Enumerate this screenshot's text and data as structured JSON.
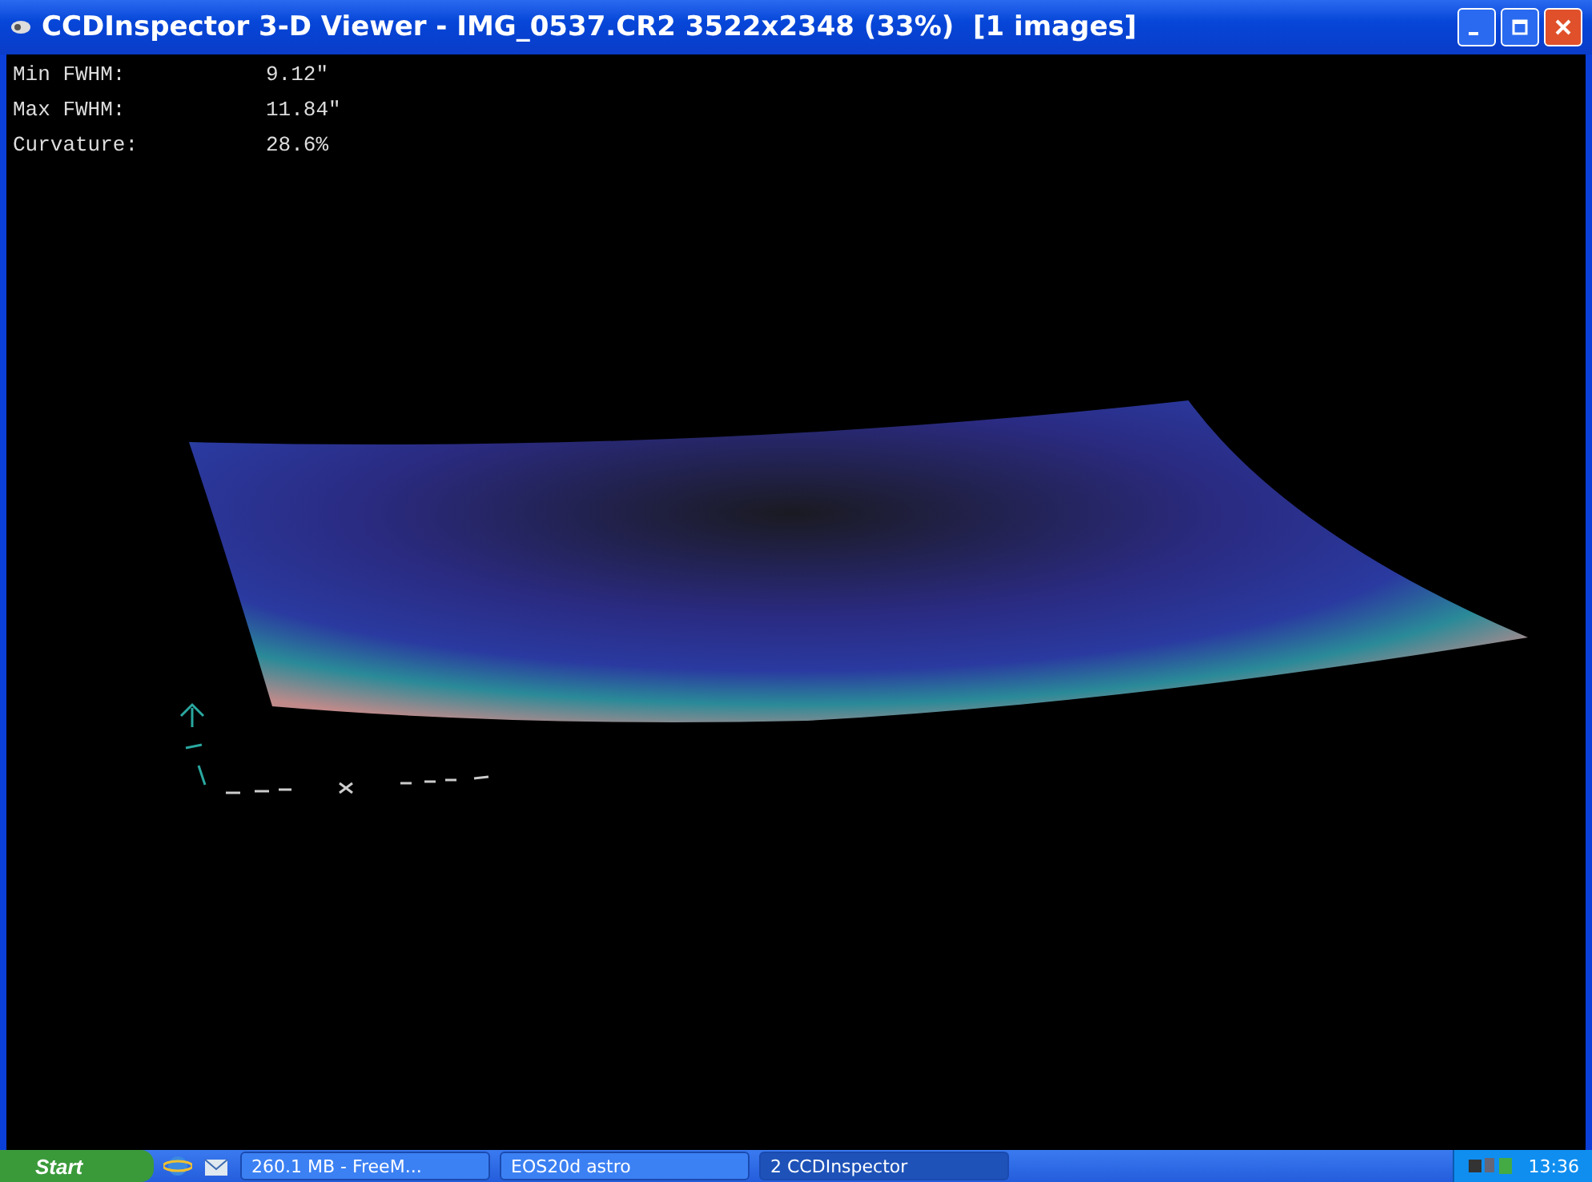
{
  "window": {
    "title": "CCDInspector 3-D Viewer - IMG_0537.CR2 3522x2348 (33%)  [1 images]"
  },
  "stats": [
    {
      "label": "Min FWHM:",
      "value": "9.12\""
    },
    {
      "label": "Max FWHM:",
      "value": "11.84\""
    },
    {
      "label": "Curvature:",
      "value": "28.6%"
    }
  ],
  "taskbar": {
    "start": "Start",
    "tasks": [
      {
        "label": "260.1 MB - FreeM...",
        "selected": false
      },
      {
        "label": "EOS20d astro",
        "selected": false
      },
      {
        "label": "2 CCDInspector",
        "selected": true
      }
    ],
    "clock": "13:36"
  }
}
